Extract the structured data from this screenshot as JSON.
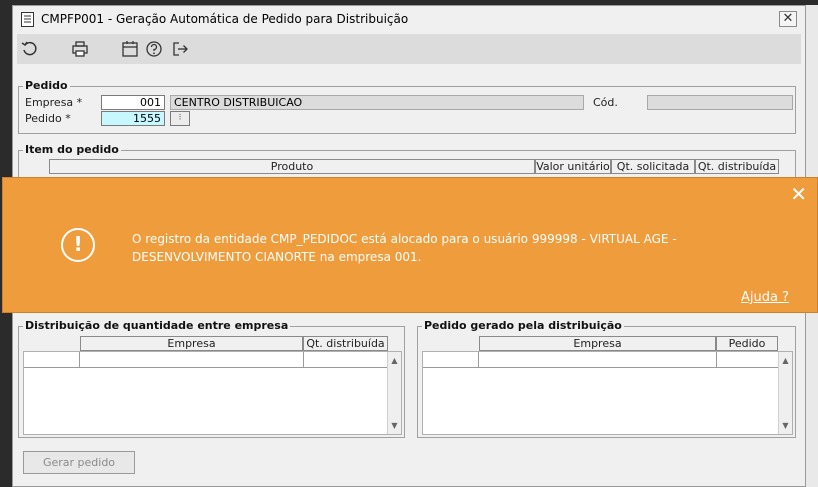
{
  "window": {
    "title": "CMPFP001 - Geração Automática de Pedido para Distribuição",
    "close_glyph": "✕"
  },
  "toolbar": {
    "icons": [
      "refresh-icon",
      "print-icon",
      "calendar-icon",
      "help-icon",
      "exit-icon"
    ]
  },
  "pedido": {
    "legend": "Pedido",
    "empresa_label": "Empresa *",
    "empresa_value": "001",
    "empresa_name": "CENTRO DISTRIBUICAO",
    "cod_label": "Cód.",
    "cod_value": "",
    "pedido_label": "Pedido *",
    "pedido_value": "1555"
  },
  "item": {
    "legend": "Item do pedido",
    "columns": [
      "Produto",
      "Valor unitário",
      "Qt. solicitada",
      "Qt. distribuída"
    ]
  },
  "distribuicao": {
    "legend": "Distribuição de quantidade entre empresa",
    "columns": [
      "Empresa",
      "Qt. distribuída"
    ]
  },
  "gerado": {
    "legend": "Pedido gerado pela distribuição",
    "columns": [
      "Empresa",
      "Pedido"
    ]
  },
  "actions": {
    "gerar_label": "Gerar pedido"
  },
  "toast": {
    "message": "O registro da entidade CMP_PEDIDOC está alocado para o usuário 999998 - VIRTUAL AGE - DESENVOLVIMENTO CIANORTE na empresa 001.",
    "help_link": "Ajuda ?",
    "close_glyph": "✕",
    "icon_glyph": "!",
    "color": "#ef9d3c"
  }
}
